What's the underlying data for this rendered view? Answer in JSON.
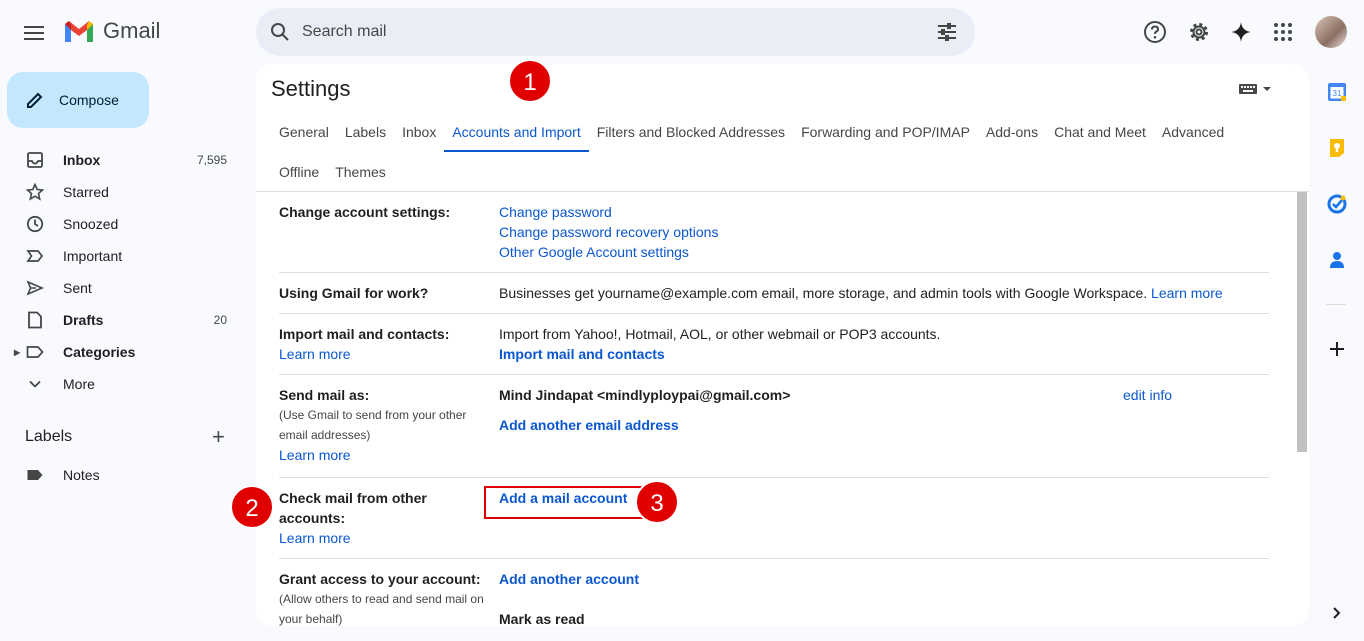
{
  "app": {
    "name": "Gmail"
  },
  "search": {
    "placeholder": "Search mail"
  },
  "compose": {
    "label": "Compose"
  },
  "nav": [
    {
      "label": "Inbox",
      "count": "7,595",
      "bold": true,
      "icon": "inbox-icon"
    },
    {
      "label": "Starred",
      "count": "",
      "bold": false,
      "icon": "star-icon"
    },
    {
      "label": "Snoozed",
      "count": "",
      "bold": false,
      "icon": "clock-icon"
    },
    {
      "label": "Important",
      "count": "",
      "bold": false,
      "icon": "important-icon"
    },
    {
      "label": "Sent",
      "count": "",
      "bold": false,
      "icon": "send-icon"
    },
    {
      "label": "Drafts",
      "count": "20",
      "bold": true,
      "icon": "draft-icon"
    },
    {
      "label": "Categories",
      "count": "",
      "bold": true,
      "icon": "label-icon"
    },
    {
      "label": "More",
      "count": "",
      "bold": false,
      "icon": "chevron-down-icon"
    }
  ],
  "labels": {
    "heading": "Labels",
    "items": [
      "Notes"
    ]
  },
  "settings": {
    "title": "Settings",
    "tabs_row1": [
      "General",
      "Labels",
      "Inbox",
      "Accounts and Import",
      "Filters and Blocked Addresses",
      "Forwarding and POP/IMAP",
      "Add-ons",
      "Chat and Meet",
      "Advanced"
    ],
    "tabs_row2": [
      "Offline",
      "Themes"
    ],
    "active_tab": "Accounts and Import",
    "sections": {
      "change_account": {
        "label": "Change account settings:",
        "links": [
          "Change password",
          "Change password recovery options",
          "Other Google Account settings"
        ]
      },
      "work": {
        "label": "Using Gmail for work?",
        "text": "Businesses get yourname@example.com email, more storage, and admin tools with Google Workspace.",
        "link": "Learn more"
      },
      "import": {
        "label": "Import mail and contacts:",
        "learn_more": "Learn more",
        "text": "Import from Yahoo!, Hotmail, AOL, or other webmail or POP3 accounts.",
        "link": "Import mail and contacts"
      },
      "send_as": {
        "label": "Send mail as:",
        "note": "(Use Gmail to send from your other email addresses)",
        "learn_more": "Learn more",
        "address": "Mind Jindapat <mindlyploypai@gmail.com>",
        "edit": "edit info",
        "link": "Add another email address"
      },
      "check_mail": {
        "label": "Check mail from other accounts:",
        "learn_more": "Learn more",
        "link": "Add a mail account"
      },
      "grant": {
        "label": "Grant access to your account:",
        "note": "(Allow others to read and send mail on your behalf)",
        "link": "Add another account",
        "mark": "Mark as read"
      }
    }
  },
  "callouts": [
    "1",
    "2",
    "3"
  ],
  "colors": {
    "accent": "#0b57d0",
    "callout": "#e00000",
    "compose": "#c2e7ff"
  }
}
